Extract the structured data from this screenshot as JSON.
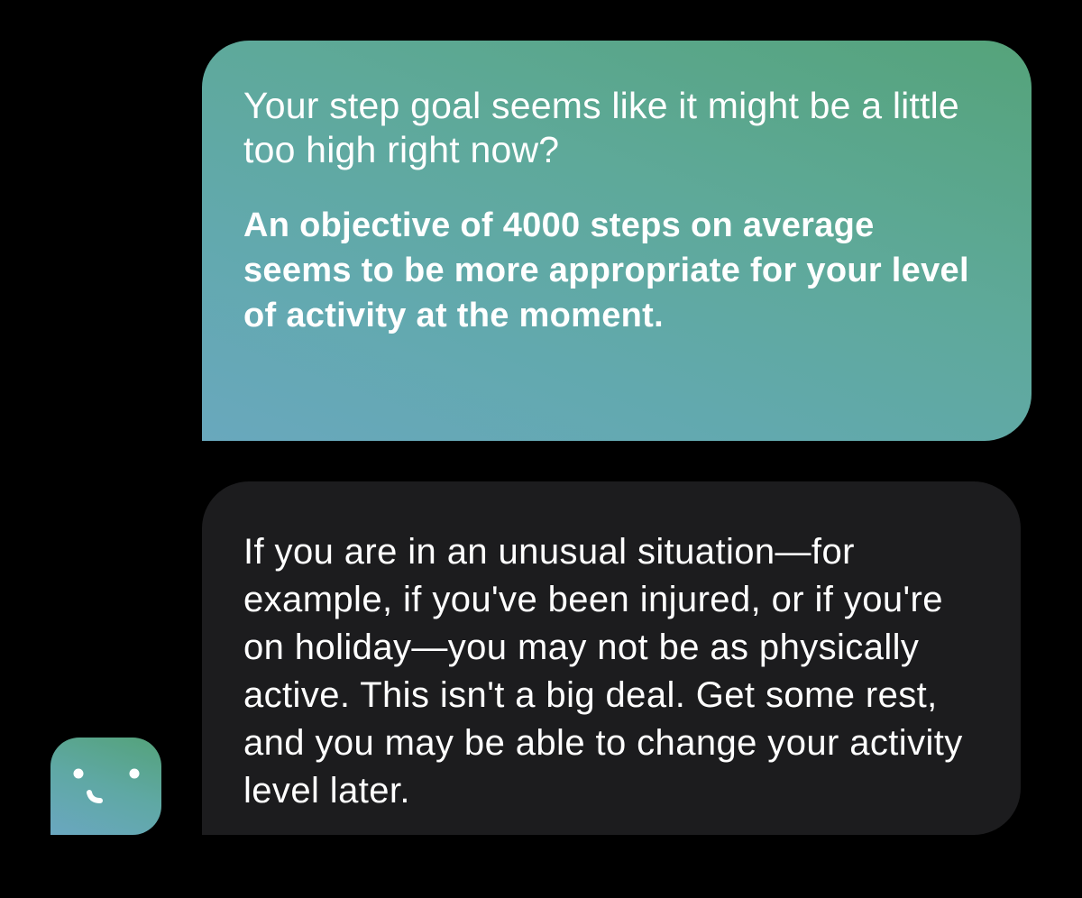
{
  "messages": {
    "coach_suggestion": {
      "question": "Your step goal seems like it might be a little too high right now?",
      "recommendation": "An objective of 4000 steps on average seems to be more appropriate for your level of activity at the moment."
    },
    "coach_followup": {
      "text": "If you are in an unusual situation—for example, if you've been injured, or if you're on holiday—you may not be as physically active. This isn't a big deal. Get some rest, and you may be able to change your activity level later."
    }
  },
  "avatar": {
    "icon": "smiley-face-icon"
  },
  "colors": {
    "background": "#000000",
    "bubble_gradient_start": "#69a8bd",
    "bubble_gradient_end": "#55a37a",
    "dark_bubble": "#1c1c1e",
    "text": "#ffffff"
  }
}
